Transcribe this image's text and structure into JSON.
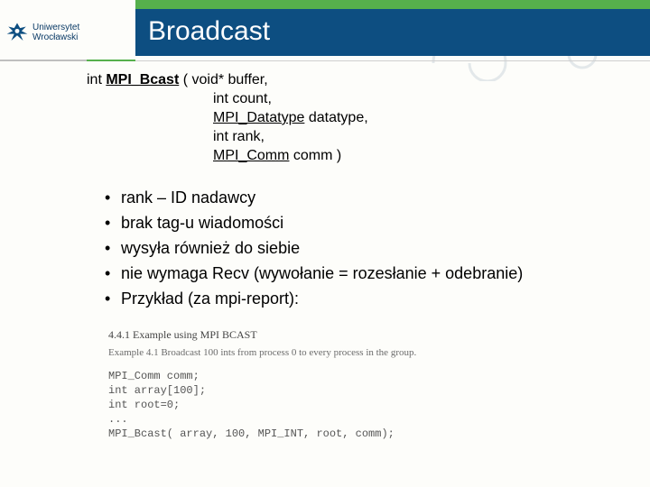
{
  "logo": {
    "line1": "Uniwersytet",
    "line2": "Wrocławski"
  },
  "title": "Broadcast",
  "code": {
    "prefix": "int ",
    "fn": "MPI_Bcast",
    "open": " (     void* buffer,",
    "params": [
      "int count,",
      "MPI_Datatype datatype,",
      "int rank,",
      "MPI_Comm comm )"
    ],
    "underline_params": {
      "MPI_Datatype": true,
      "MPI_Comm": true
    }
  },
  "bullets": [
    "rank – ID nadawcy",
    "brak tag-u wiadomości",
    "wysyła również do siebie",
    "nie wymaga Recv (wywołanie = rozesłanie + odebranie)",
    "Przykład (za mpi-report):"
  ],
  "example": {
    "heading": "4.4.1    Example using MPI BCAST",
    "caption": "Example 4.1 Broadcast 100 ints from process 0 to every process in the group.",
    "code_lines": [
      "MPI_Comm comm;",
      "int array[100];",
      "int root=0;",
      "...",
      "MPI_Bcast( array, 100, MPI_INT, root, comm);"
    ]
  }
}
